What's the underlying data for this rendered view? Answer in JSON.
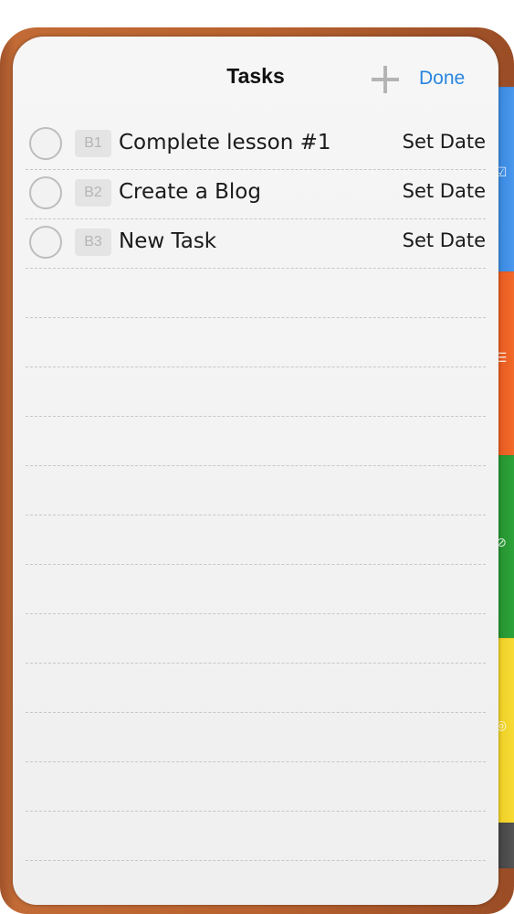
{
  "header": {
    "title": "Tasks",
    "done_label": "Done"
  },
  "tasks": [
    {
      "code": "B1",
      "name": "Complete lesson #1",
      "date_label": "Set Date"
    },
    {
      "code": "B2",
      "name": "Create a Blog",
      "date_label": "Set Date"
    },
    {
      "code": "B3",
      "name": "New Task",
      "date_label": "Set Date"
    }
  ],
  "side_tabs": [
    {
      "color": "#3a8ae4",
      "icon": "checkbox-icon"
    },
    {
      "color": "#ea5d21",
      "icon": "list-icon"
    },
    {
      "color": "#269632",
      "icon": "compass-icon"
    },
    {
      "color": "#f0d128",
      "icon": "target-icon"
    },
    {
      "color": "#444444",
      "icon": "none"
    }
  ],
  "colors": {
    "accent": "#2a86e0",
    "cover": "#b8622f"
  }
}
